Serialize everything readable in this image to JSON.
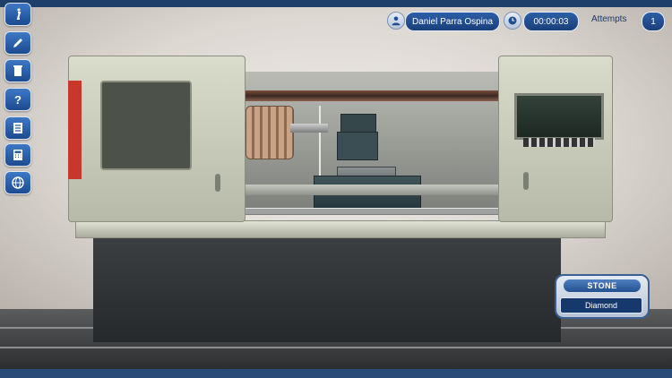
{
  "hud": {
    "user_name": "Daniel Parra Ospina",
    "timer": "00:00:03",
    "attempts_label": "Attempts",
    "attempts_value": "1"
  },
  "toolbar": {
    "items": [
      {
        "name": "info-button",
        "icon": "info-icon"
      },
      {
        "name": "edit-button",
        "icon": "pencil-icon"
      },
      {
        "name": "delete-button",
        "icon": "trash-icon"
      },
      {
        "name": "help-button",
        "icon": "question-icon"
      },
      {
        "name": "list-button",
        "icon": "list-icon"
      },
      {
        "name": "calculator-button",
        "icon": "calculator-icon"
      },
      {
        "name": "globe-button",
        "icon": "globe-icon"
      }
    ]
  },
  "stone_panel": {
    "title": "STONE",
    "value": "Diamond"
  },
  "colors": {
    "hud_blue": "#1f4f8f",
    "frame_navy": "#1f3f6b",
    "machine_cream": "#d3d6c4",
    "accent_red": "#c7382a"
  }
}
